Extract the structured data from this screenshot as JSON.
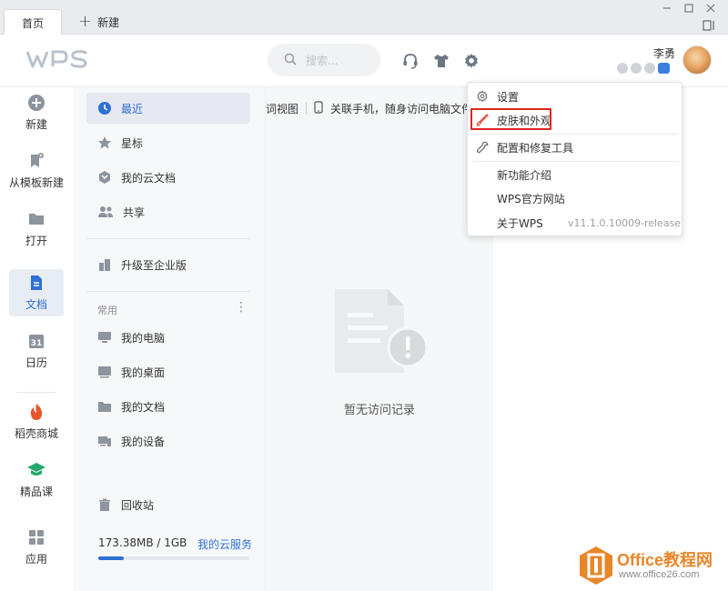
{
  "tabs": {
    "home_label": "首页",
    "new_label": "新建"
  },
  "header": {
    "logo_text": "WPS",
    "search_placeholder": "搜索...",
    "user_name": "李勇"
  },
  "rail": {
    "items": [
      {
        "label": "新建",
        "icon": "plus-circle-icon"
      },
      {
        "label": "从模板新建",
        "icon": "template-icon"
      },
      {
        "label": "打开",
        "icon": "folder-icon"
      },
      {
        "label": "文档",
        "icon": "document-icon"
      },
      {
        "label": "日历",
        "icon": "calendar-icon"
      },
      {
        "label": "稻壳商城",
        "icon": "docer-icon"
      },
      {
        "label": "精品课",
        "icon": "course-icon"
      },
      {
        "label": "应用",
        "icon": "apps-icon"
      }
    ],
    "calendar_day": "31",
    "active": "文档"
  },
  "nav": {
    "items": [
      {
        "label": "最近",
        "icon": "clock-icon"
      },
      {
        "label": "星标",
        "icon": "star-icon"
      },
      {
        "label": "我的云文档",
        "icon": "cloud-doc-icon"
      },
      {
        "label": "共享",
        "icon": "share-icon"
      }
    ],
    "upgrade_label": "升级至企业版",
    "section_label": "常用",
    "common": [
      {
        "label": "我的电脑",
        "icon": "computer-icon"
      },
      {
        "label": "我的桌面",
        "icon": "desktop-icon"
      },
      {
        "label": "我的文档",
        "icon": "documents-folder-icon"
      },
      {
        "label": "我的设备",
        "icon": "devices-icon"
      }
    ],
    "recycle_label": "回收站",
    "storage_text": "173.38MB / 1GB",
    "storage_link": "我的云服务",
    "storage_fraction": 0.17
  },
  "content": {
    "view_label": "词视图",
    "phone_label": "关联手机，随身访问电脑文件",
    "empty_text": "暂无访问记录"
  },
  "menu": {
    "items": [
      {
        "label": "设置",
        "icon": "gear-icon"
      },
      {
        "label": "皮肤和外观",
        "icon": "brush-icon"
      },
      {
        "label": "配置和修复工具",
        "icon": "wrench-icon"
      },
      {
        "label": "新功能介绍"
      },
      {
        "label": "WPS官方网站"
      },
      {
        "label": "关于WPS"
      }
    ],
    "version": "v11.1.0.10009-release",
    "highlighted": "皮肤和外观",
    "highlight_color": "#e02424"
  },
  "watermark": {
    "title": "Office教程网",
    "url": "www.office26.com"
  },
  "colors": {
    "accent": "#2f6fd6",
    "watermark": "#e8862a"
  }
}
